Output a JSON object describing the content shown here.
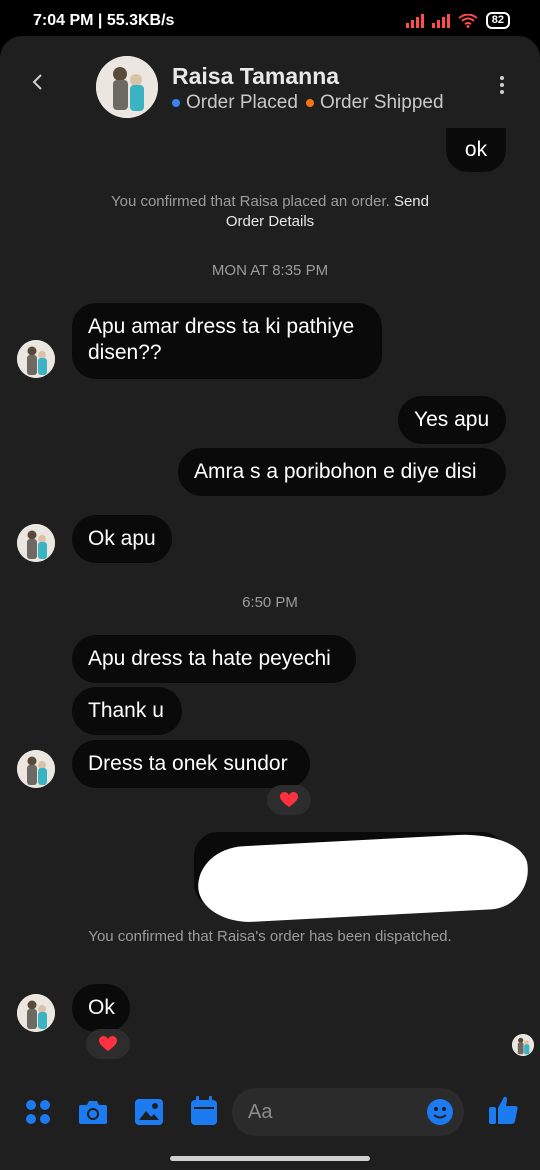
{
  "status": {
    "time": "7:04 PM | 55.3KB/s",
    "battery": "82"
  },
  "header": {
    "name": "Raisa Tamanna",
    "tag1": "Order Placed",
    "tag2": "Order Shipped",
    "tag1_color": "#3b82f6",
    "tag2_color": "#f97316"
  },
  "messages": {
    "ok_sent": "ok",
    "sys1_text": "You confirmed that Raisa placed an order.",
    "sys1_link": "Send",
    "sys1_text2": "Order Details",
    "time1": "MON AT 8:35 PM",
    "in1": "Apu amar dress ta ki pathiye disen??",
    "out1": "Yes apu",
    "out2": "Amra s a poribohon e diye disi",
    "in2": "Ok apu",
    "time2": "6:50 PM",
    "in3": "Apu dress ta hate peyechi",
    "in4": "Thank u",
    "in5": "Dress ta onek sundor",
    "sys2": "You confirmed that Raisa's order has been dispatched.",
    "in6": "Ok"
  },
  "composer": {
    "placeholder": "Aa"
  },
  "colors": {
    "accent": "#1d7bf2",
    "heart": "#ff3040"
  },
  "icons": [
    "back-icon",
    "more-icon",
    "apps-icon",
    "camera-icon",
    "gallery-icon",
    "calendar-icon",
    "emoji-icon",
    "like-icon",
    "heart-icon"
  ]
}
